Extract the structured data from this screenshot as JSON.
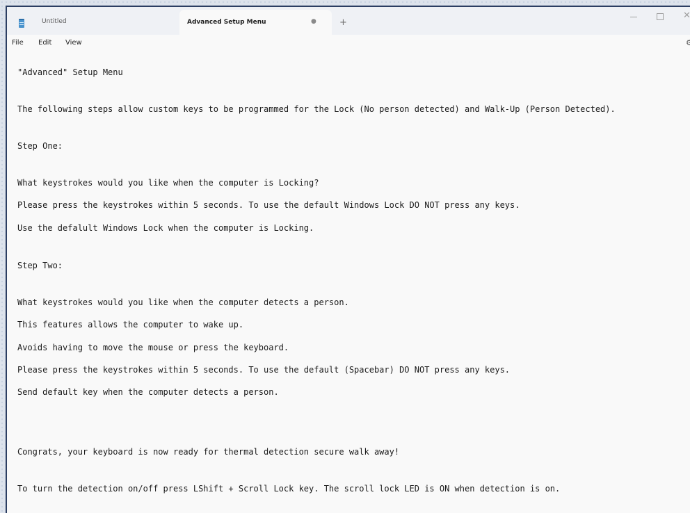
{
  "tabs": [
    {
      "label": "Untitled",
      "active": false
    },
    {
      "label": "Advanced Setup Menu",
      "active": true
    }
  ],
  "icons": {
    "app": "notepad-icon",
    "tab_status": "unsaved-dot-icon",
    "new_tab": "plus-icon",
    "minimize": "minimize-icon",
    "maximize": "maximize-icon",
    "close": "close-icon",
    "settings": "gear-icon"
  },
  "glyphs": {
    "dot": "●",
    "plus": "+",
    "close": "✕",
    "gear": "⚙"
  },
  "menu": [
    "File",
    "Edit",
    "View"
  ],
  "document": {
    "lines": [
      "\"Advanced\" Setup Menu",
      "The following steps allow custom keys to be programmed for the Lock (No person detected) and Walk-Up (Person Detected).",
      "Step One:",
      "What keystrokes would you like when the computer is Locking?",
      "Please press the keystrokes within 5 seconds. To use the default Windows Lock DO NOT press any keys.",
      "Use the defalult Windows Lock when the computer is Locking.",
      "Step Two:",
      "What keystrokes would you like when the computer detects a person.",
      "This features allows the computer to wake up.",
      "Avoids having to move the mouse or press the keyboard.",
      "Please press the keystrokes within 5 seconds. To use the default (Spacebar) DO NOT press any keys.",
      "Send default key when the computer detects a person.",
      "Congrats, your keyboard is now ready for thermal detection secure walk away!",
      "To turn the detection on/off press LShift + Scroll Lock key. The scroll lock LED is ON when detection is on."
    ]
  },
  "colors": {
    "window_border": "#2c3e62",
    "tab_bar": "#eff1f5",
    "editor_background": "#f9f9f9",
    "text": "#1b1b1b"
  }
}
